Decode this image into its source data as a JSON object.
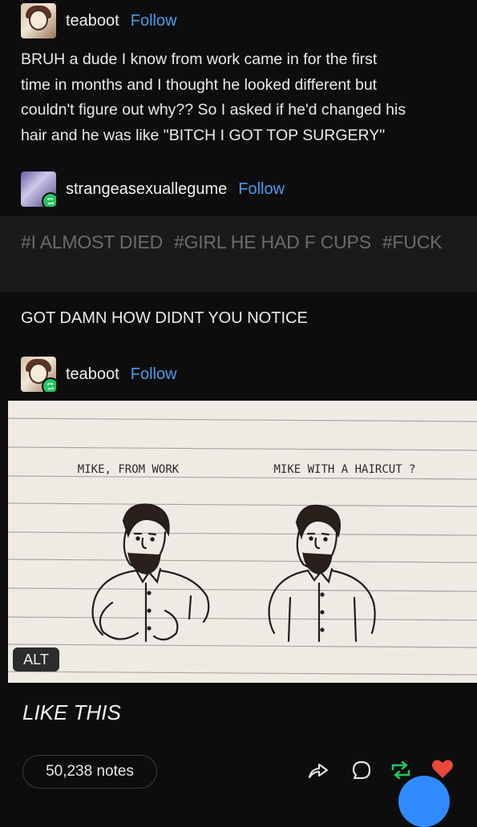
{
  "posts": [
    {
      "username": "teaboot",
      "follow_label": "Follow",
      "text": [
        "BRUH a dude I know from work came in for the first",
        "time in months and I thought he looked different but",
        "couldn't figure out why?? So I asked if he'd changed his",
        "hair and he was like \"BITCH I GOT TOP SURGERY\""
      ]
    },
    {
      "username": "strangeasexuallegume",
      "follow_label": "Follow",
      "tags": [
        "#I ALMOST DIED",
        "#GIRL HE HAD F CUPS",
        "#FUCK"
      ],
      "text": "GOT DAMN HOW DIDNT YOU NOTICE"
    },
    {
      "username": "teaboot",
      "follow_label": "Follow",
      "drawing": {
        "left_caption": "MIKE, FROM WORK",
        "right_caption": "MIKE WITH A HAIRCUT ?"
      },
      "alt_label": "ALT",
      "text": "LIKE THIS"
    }
  ],
  "footer": {
    "notes": "50,238 notes",
    "icons": [
      "share-icon",
      "comment-icon",
      "reblog-icon",
      "like-icon"
    ]
  },
  "colors": {
    "background": "#0d0d0d",
    "link": "#4b9bea",
    "reblog": "#22c55e",
    "like": "#e8493b",
    "tag": "#6b6b6b"
  }
}
